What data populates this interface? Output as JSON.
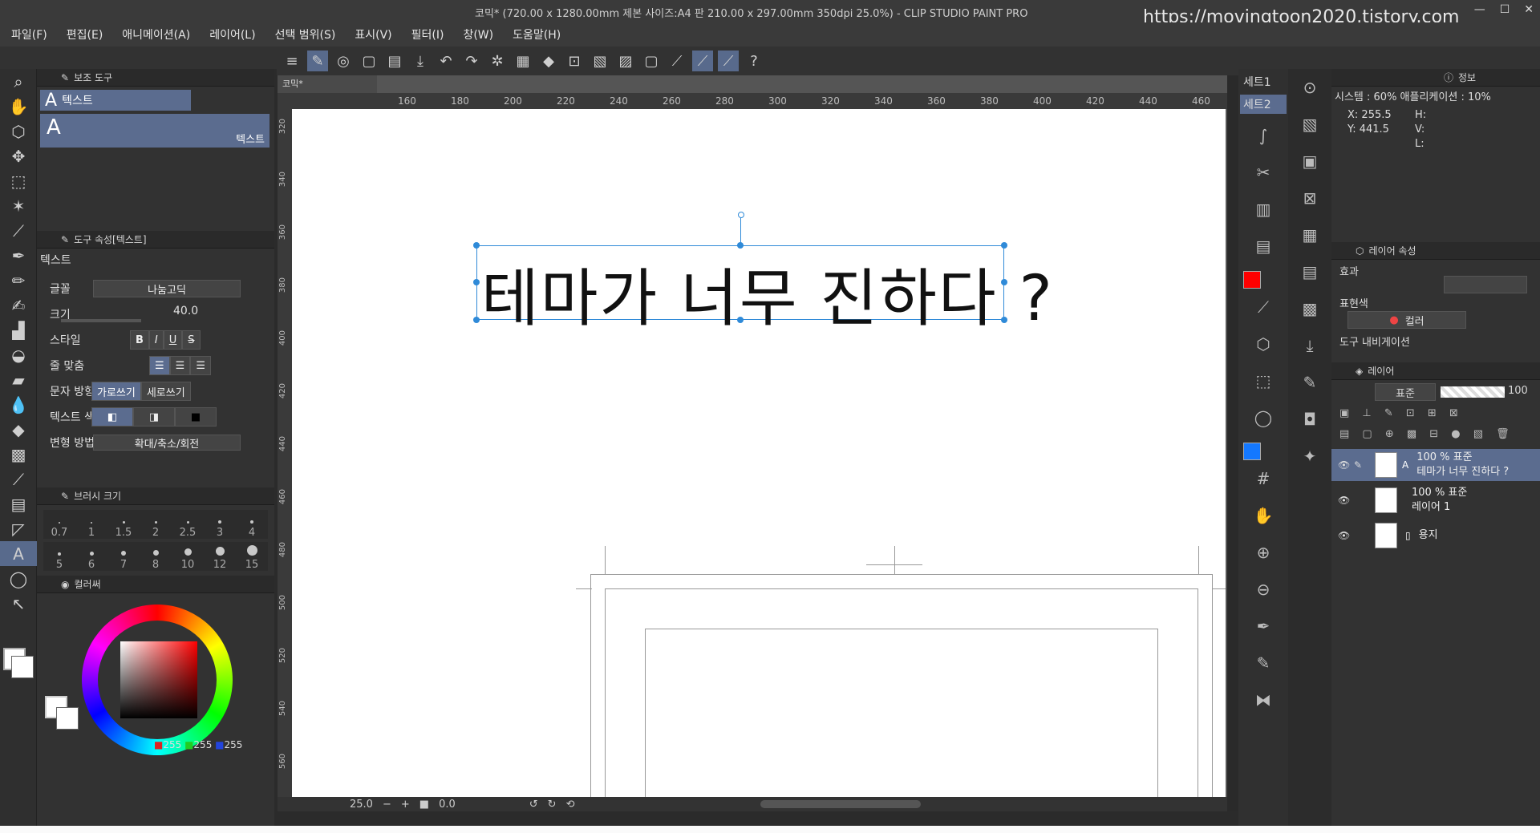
{
  "window": {
    "title": "코믹* (720.00 x 1280.00mm 제본 사이즈:A4 판 210.00 x 297.00mm 350dpi 25.0%)  - CLIP STUDIO PAINT PRO",
    "watermark": "https://movingtoon2020.tistory.com"
  },
  "menu": [
    "파일(F)",
    "편집(E)",
    "애니메이션(A)",
    "레이어(L)",
    "선택 범위(S)",
    "표시(V)",
    "필터(I)",
    "창(W)",
    "도움말(H)"
  ],
  "subtool": {
    "panel_title": "보조 도구",
    "selected_label": "텍스트",
    "group_label": "텍스트"
  },
  "tool_property": {
    "panel_title": "도구 속성[텍스트]",
    "section": "텍스트",
    "font_label": "글꼴",
    "font_value": "나눔고딕",
    "size_label": "크기",
    "size_value": "40.0",
    "style_label": "스타일",
    "align_label": "줄 맞춤",
    "direction_label": "문자 방향",
    "horizontal_label": "가로쓰기",
    "vertical_label": "세로쓰기",
    "text_color_label": "텍스트 색",
    "transform_label": "변형 방법",
    "transform_value": "확대/축소/회전"
  },
  "brush_size": {
    "panel_title": "브러시 크기",
    "sizes": [
      "0.7",
      "1",
      "1.5",
      "2",
      "2.5",
      "3",
      "4",
      "5",
      "6",
      "7",
      "8",
      "10",
      "12",
      "15"
    ]
  },
  "color_panel": {
    "title": "컬러써",
    "r": "255",
    "g": "255",
    "b": "255"
  },
  "document": {
    "tab": "코믹*",
    "canvas_text": "테마가 너무 진하다 ?",
    "zoom": "25.0",
    "angle": "0.0",
    "ruler_top": [
      "160",
      "180",
      "200",
      "220",
      "240",
      "260",
      "280",
      "300",
      "320",
      "340",
      "360",
      "380",
      "400",
      "420",
      "440",
      "460"
    ],
    "ruler_left": [
      "320",
      "340",
      "360",
      "380",
      "400",
      "420",
      "440",
      "460",
      "480",
      "500",
      "520",
      "540",
      "560"
    ]
  },
  "sets": [
    "세트1",
    "세트2"
  ],
  "info": {
    "title": "정보",
    "system": "시스템 : 60% 애플리케이션 : 10%",
    "x": "X: 255.5",
    "y": "Y: 441.5",
    "h": "H:",
    "v": "V:",
    "l": "L:"
  },
  "layer_property": {
    "title": "레이어 속성",
    "effect": "효과",
    "expression_color_label": "표현색",
    "expression_color_value": "컬러",
    "tool_navigation": "도구 내비게이션"
  },
  "layers": {
    "title": "레이어",
    "blend": "표준",
    "opacity": "100",
    "items": [
      {
        "top": "100 % 표준",
        "name": "테마가 너무 진하다 ?"
      },
      {
        "top": "100 % 표준",
        "name": "레이어 1"
      },
      {
        "top": "",
        "name": "용지"
      }
    ]
  },
  "colors": {
    "accent": "#5b6c8f",
    "selection": "#2f8ad8",
    "main_color": "#ff0000",
    "sub_color": "#1478ff"
  }
}
